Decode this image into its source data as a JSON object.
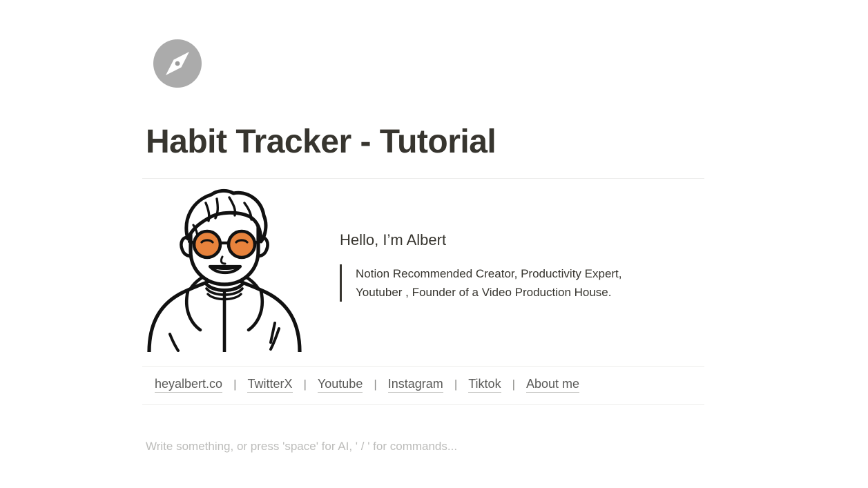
{
  "page": {
    "background_color": "#ffffff",
    "icon": {
      "name": "compass-icon",
      "circle_color": "#ababab",
      "needle_color": "#ffffff"
    },
    "title": "Habit Tracker - Tutorial",
    "title_color": "#37352f"
  },
  "profile": {
    "avatar": {
      "name": "albert-avatar-illustration",
      "alt": "Line-art portrait of a smiling man with orange round sunglasses and a white hoodie",
      "line_color": "#111111",
      "lens_color": "#e8833c",
      "fill_color": "#ffffff"
    },
    "heading": "Hello, I’m Albert",
    "quote": {
      "line1": "Notion Recommended Creator, Productivity Expert,",
      "line2": "Youtuber , Founder of a Video Production House.",
      "bar_color": "#37352f"
    }
  },
  "links": {
    "separator": "|",
    "items": [
      {
        "label": "heyalbert.co"
      },
      {
        "label": "TwitterX"
      },
      {
        "label": "Youtube"
      },
      {
        "label": "Instagram"
      },
      {
        "label": "Tiktok"
      },
      {
        "label": "About me"
      }
    ]
  },
  "editor": {
    "placeholder": "Write something, or press 'space' for AI, ' / ' for commands..."
  },
  "colors": {
    "text": "#37352f",
    "muted_text": "#5a5a58",
    "placeholder": "#bcbcba",
    "divider": "#ececeb",
    "accent_orange": "#e8833c",
    "icon_gray": "#ababab"
  }
}
